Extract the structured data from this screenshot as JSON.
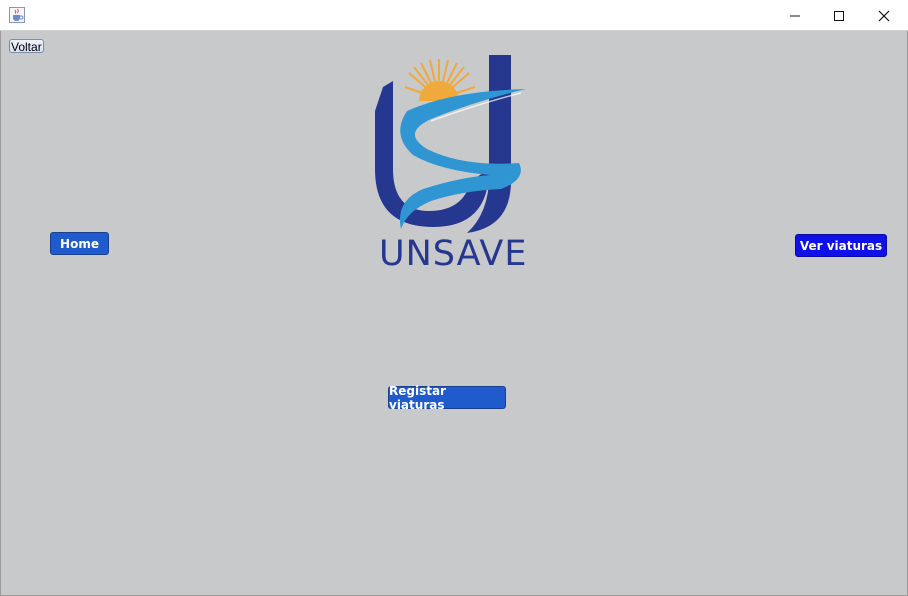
{
  "window": {
    "app_icon": "java-cup-icon",
    "controls": [
      "minimize-icon",
      "maximize-icon",
      "close-icon"
    ]
  },
  "buttons": {
    "voltar": "Voltar",
    "home": "Home",
    "ver_viaturas": "Ver viaturas",
    "registar_viaturas": "Registar viaturas"
  },
  "logo": {
    "text": "UNSAVE",
    "colors": {
      "navy": "#25378f",
      "sky": "#2f95d3",
      "sun": "#f0a93b"
    }
  },
  "colors": {
    "background": "#c8c9cb",
    "button_blue": "#1f5bcc",
    "button_bright_blue": "#1010e8"
  }
}
